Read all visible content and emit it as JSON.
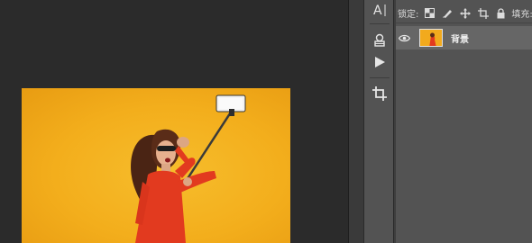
{
  "tools": [
    {
      "name": "type-tool",
      "glyph": "A"
    },
    {
      "name": "3d-tool"
    },
    {
      "name": "play-button"
    },
    {
      "name": "crop-tool"
    }
  ],
  "layers_panel": {
    "lock_label": "锁定:",
    "fill_label": "填充:",
    "layers": [
      {
        "name": "背景",
        "visible": true
      }
    ]
  },
  "colors": {
    "canvas_bg": "#2b2b2b",
    "panel_bg": "#535353",
    "selected_layer_bg": "#666666",
    "photo_bg": "#f3ae1c",
    "dress": "#e23a1f"
  }
}
